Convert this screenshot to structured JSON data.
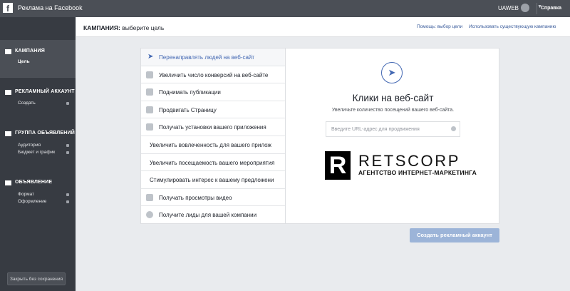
{
  "topbar": {
    "title": "Реклама на Facebook",
    "account": "UAWEB",
    "help": "Справка",
    "icons": {
      "logo": "facebook-logo",
      "globe": "globe-icon",
      "caret": "chevron-down-icon"
    }
  },
  "sidebar": {
    "sections": [
      {
        "title": "КАМПАНИЯ",
        "icon": "campaign-icon",
        "items": [
          "Цель"
        ]
      },
      {
        "title": "РЕКЛАМНЫЙ АККАУНТ",
        "icon": "megaphone-icon",
        "items": [
          "Создать"
        ]
      },
      {
        "title": "ГРУППА ОБЪЯВЛЕНИЙ",
        "icon": "grid-icon",
        "items": [
          "Аудитория",
          "Бюджет и график"
        ]
      },
      {
        "title": "ОБЪЯВЛЕНИЕ",
        "icon": "monitor-icon",
        "items": [
          "Формат",
          "Оформление"
        ]
      }
    ],
    "close_button": "Закрыть без сохранения"
  },
  "header": {
    "title_bold": "КАМПАНИЯ:",
    "title_rest": " выберите цель",
    "link_help": "Помощь: выбор цели",
    "link_existing": "Использовать существующую кампанию"
  },
  "objectives": [
    "Перенаправлять людей на веб-сайт",
    "Увеличить число конверсий на веб-сайте",
    "Поднимать публикации",
    "Продвигать Страницу",
    "Получать установки вашего приложения",
    "Увеличить вовлеченность для вашего прилож",
    "Увеличить посещаемость вашего мероприятия",
    "Стимулировать интерес к вашему предложени",
    "Получать просмотры видео",
    "Получите лиды для вашей компании"
  ],
  "detail": {
    "title": "Клики на веб-сайт",
    "subtitle": "Увеличьте количество посещений вашего веб-сайта.",
    "url_placeholder": "Введите URL-адрес для продвижения"
  },
  "watermark": {
    "name": "RETSCORP",
    "tagline": "АГЕНТСТВО ИНТЕРНЕТ-МАРКЕТИНГА",
    "letter": "R"
  },
  "create_button": "Создать рекламный аккаунт",
  "colors": {
    "topbar": "#4b4f56",
    "sidebar": "#373b42",
    "link": "#365899",
    "accent": "#4267b2",
    "button": "#9cb4d8"
  }
}
